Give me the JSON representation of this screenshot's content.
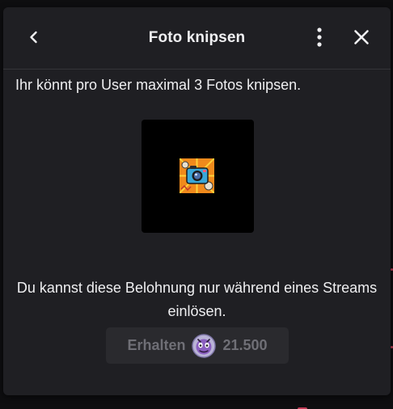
{
  "dialog": {
    "title": "Foto knipsen",
    "description": "Ihr könnt pro User maximal 3 Fotos knipsen.",
    "note": "Du kannst diese Belohnung nur während eines Streams einlösen.",
    "reward_image_icon": "camera-comic-icon"
  },
  "header": {
    "back_icon": "chevron-left-icon",
    "more_icon": "more-vertical-icon",
    "close_icon": "close-icon"
  },
  "redeem": {
    "label": "Erhalten",
    "cost": "21.500",
    "points_icon": "channel-points-icon",
    "enabled": false
  },
  "colors": {
    "panel_bg": "#1f1f23",
    "text": "#efeff1",
    "disabled_text": "#6f6f76",
    "button_bg": "#2a2a2e"
  }
}
